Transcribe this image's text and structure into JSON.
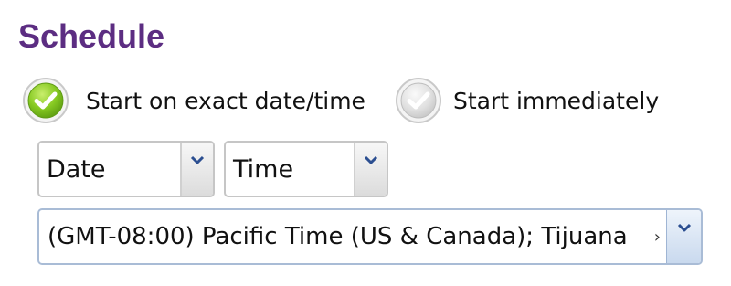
{
  "section": {
    "title": "Schedule"
  },
  "start_mode": {
    "selected": "exact",
    "options": [
      {
        "label": "Start on exact date/time",
        "icon": "check-circle-green-icon"
      },
      {
        "label": "Start immediately",
        "icon": "check-circle-gray-icon"
      }
    ]
  },
  "date_select": {
    "value": "Date",
    "icon": "chevron-down-icon"
  },
  "time_select": {
    "value": "Time",
    "icon": "chevron-down-icon"
  },
  "timezone_select": {
    "value": "(GMT-08:00) Pacific Time (US & Canada); Tijuana",
    "overflow_mark": "›",
    "icon": "chevron-down-icon"
  },
  "colors": {
    "title": "#5c2d82",
    "selected_radio": "#7cc120",
    "unselected_radio": "#cfcfcf",
    "arrow": "#2c4f91"
  }
}
